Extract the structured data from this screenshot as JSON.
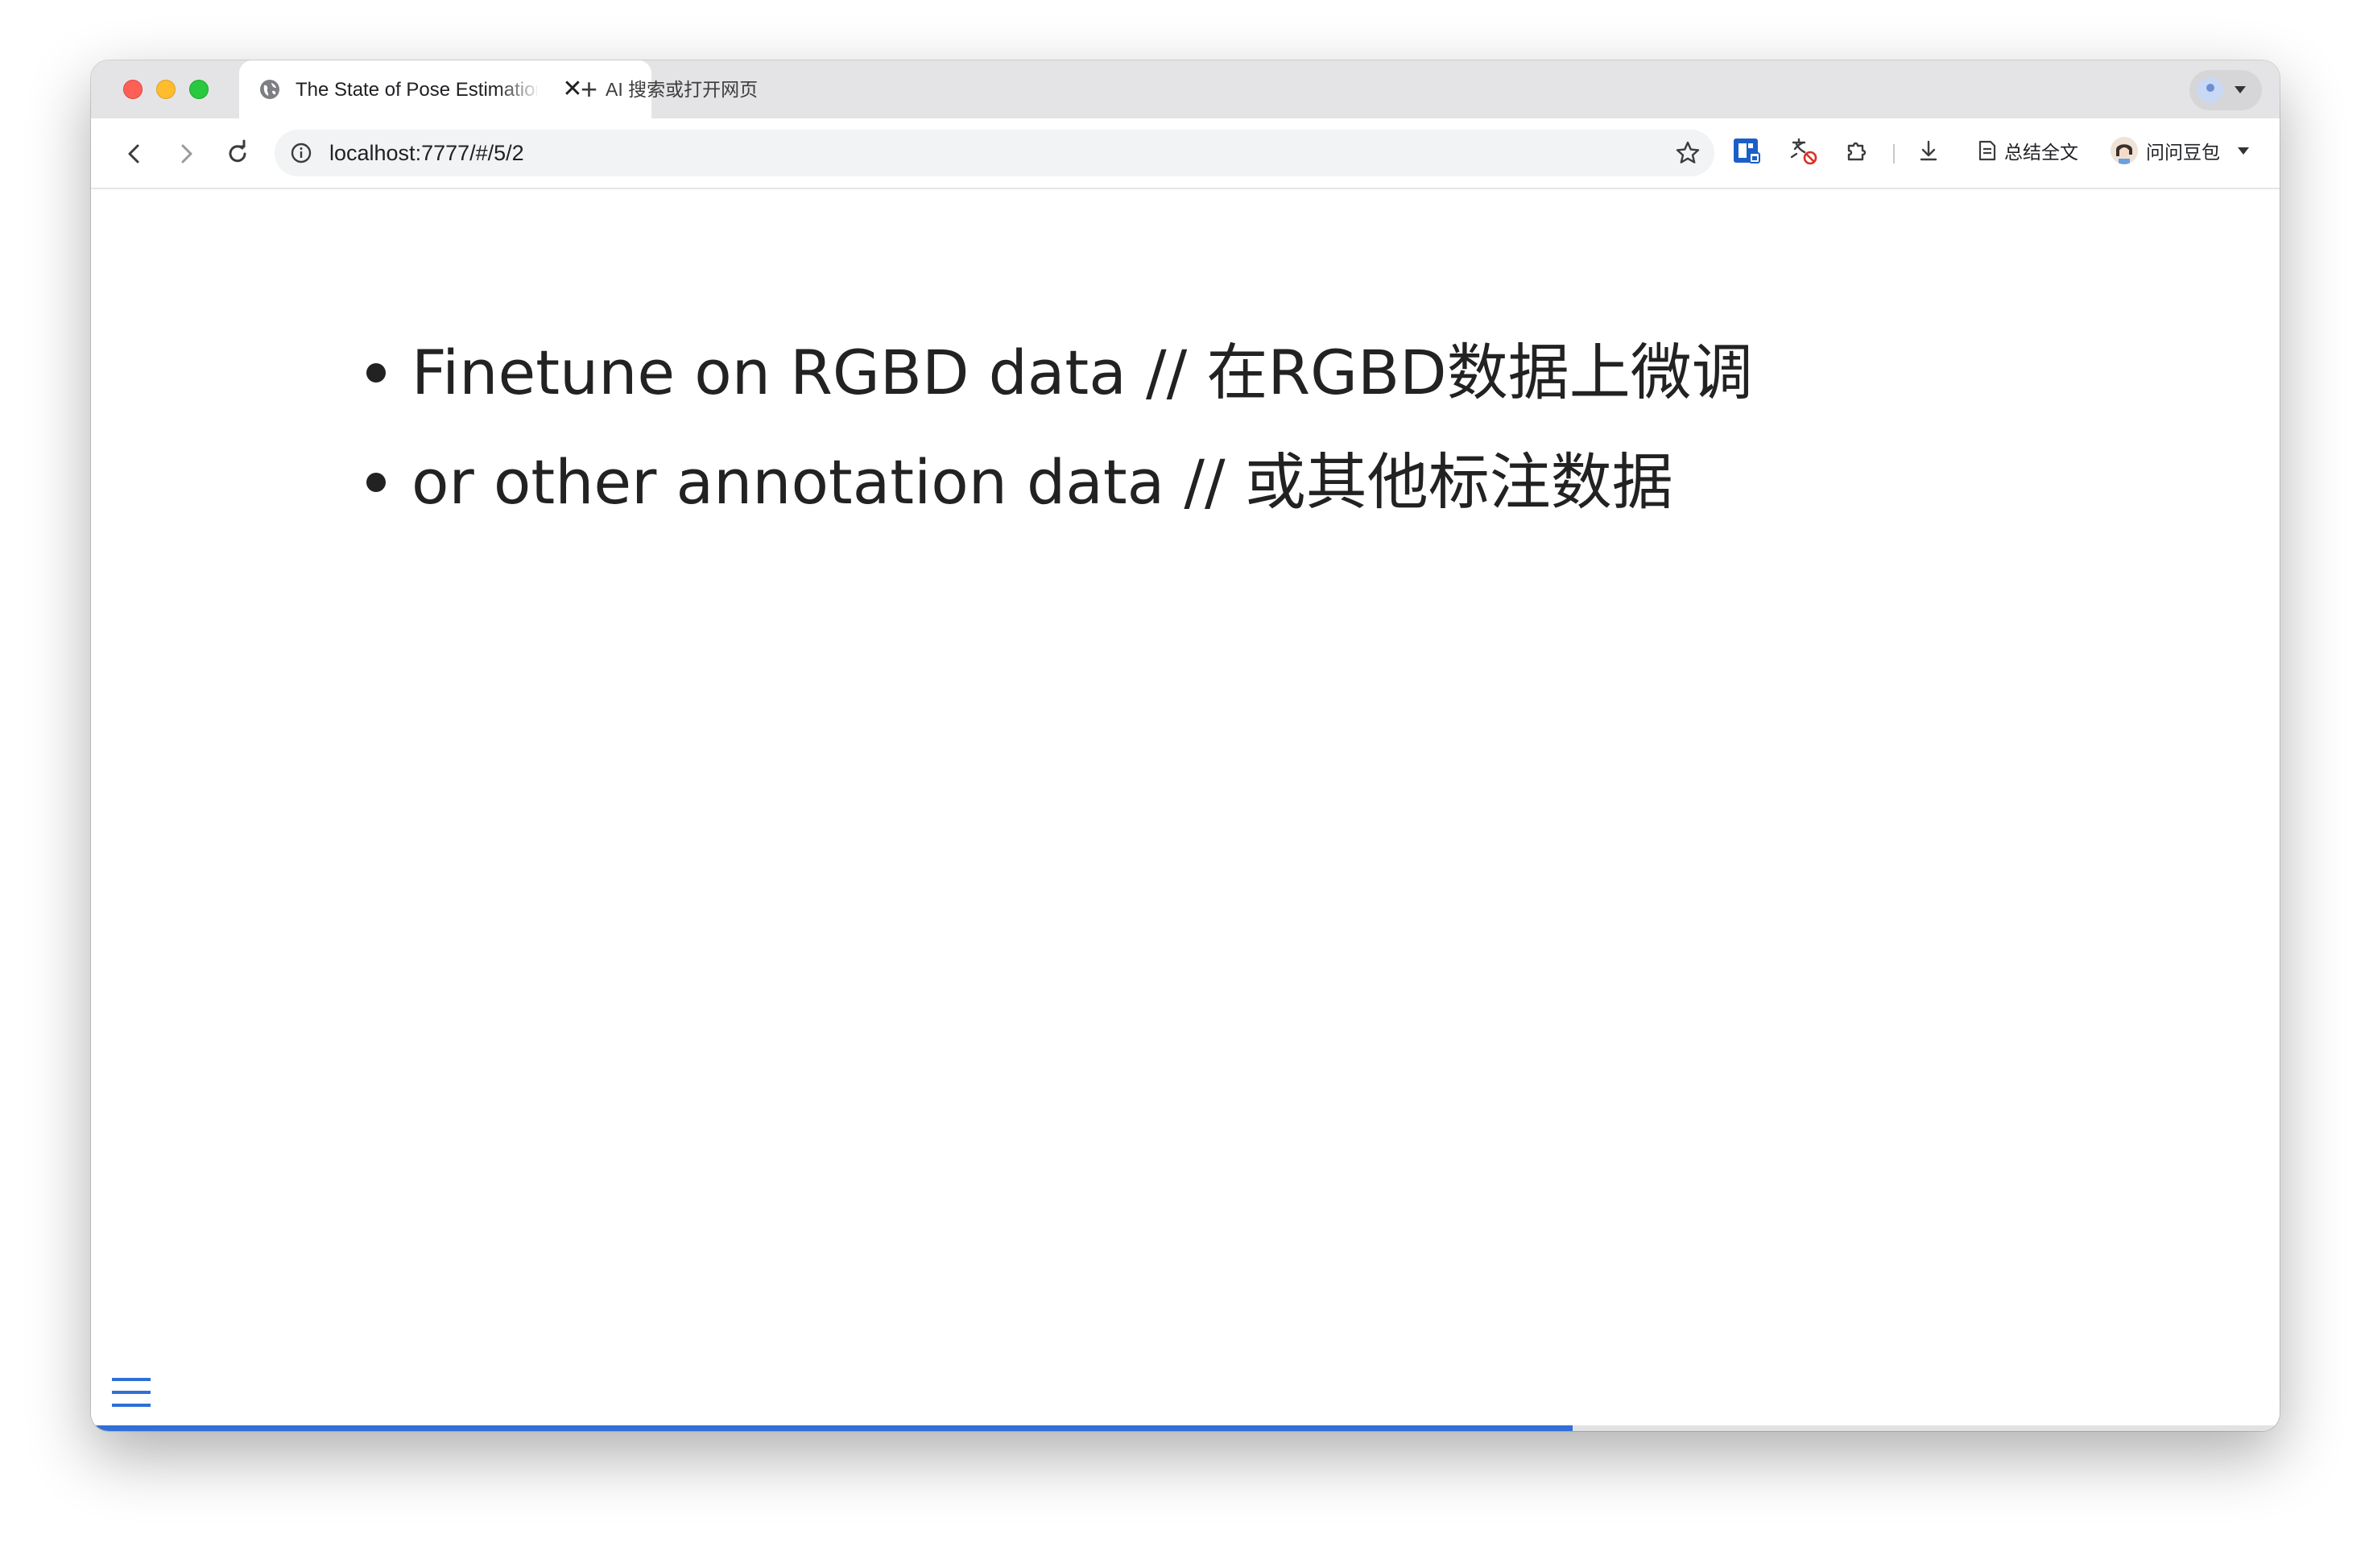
{
  "browser": {
    "tab": {
      "title": "The State of Pose Estimation",
      "close_label": "✕"
    },
    "new_tab": {
      "label": "AI 搜索或打开网页"
    },
    "address_bar": {
      "url": "localhost:7777/#/5/2"
    },
    "toolbar": {
      "summary_label": "总结全文",
      "doubao_label": "问问豆包"
    }
  },
  "slide": {
    "bullets": [
      {
        "text": "Finetune on RGBD data // 在RGBD数据上微调"
      },
      {
        "text": "or other annotation data // 或其他标注数据"
      }
    ],
    "progress": 0.677
  },
  "colors": {
    "accent": "#2f6fd6",
    "text": "#222222",
    "tabstrip": "#e4e4e6"
  },
  "icons": {
    "menu": "hamburger-menu-icon",
    "favicon": "globe-icon"
  }
}
